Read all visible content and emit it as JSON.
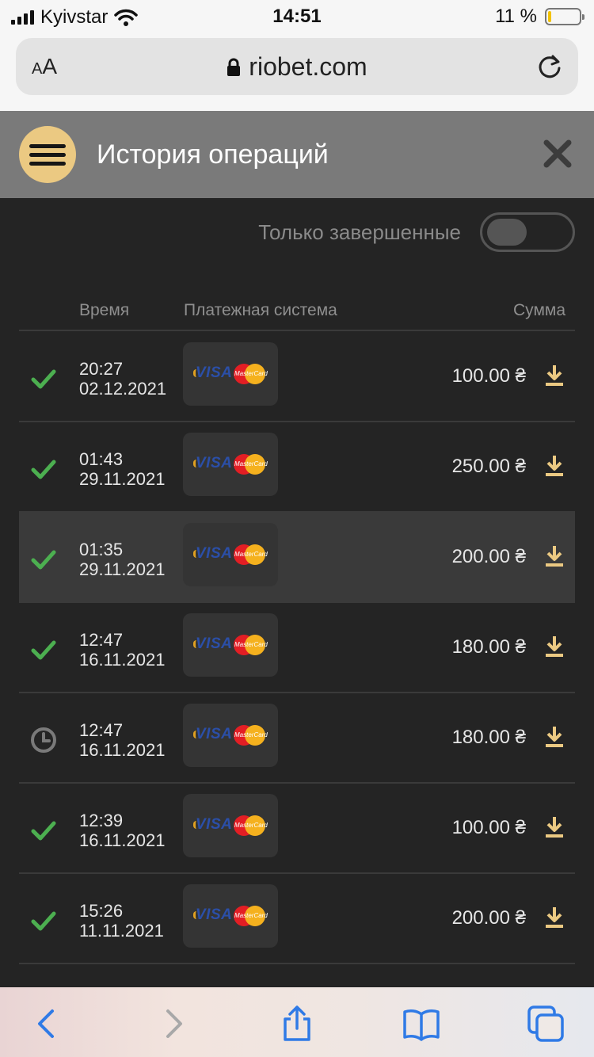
{
  "status_bar": {
    "carrier": "Kyivstar",
    "time": "14:51",
    "battery_percent": "11 %",
    "battery_level": 0.11
  },
  "browser": {
    "text_size_label": "AA",
    "url": "riobet.com"
  },
  "header": {
    "title": "История операций"
  },
  "filter": {
    "label": "Только завершенные",
    "enabled": false
  },
  "table": {
    "columns": {
      "time": "Время",
      "payment": "Платежная система",
      "amount": "Сумма"
    },
    "rows": [
      {
        "status": "completed",
        "time": "20:27",
        "date": "02.12.2021",
        "payment_icons": [
          "visa-icon",
          "mastercard-icon"
        ],
        "amount": "100.00 ₴"
      },
      {
        "status": "completed",
        "time": "01:43",
        "date": "29.11.2021",
        "payment_icons": [
          "visa-icon",
          "mastercard-icon"
        ],
        "amount": "250.00 ₴"
      },
      {
        "status": "completed",
        "time": "01:35",
        "date": "29.11.2021",
        "payment_icons": [
          "visa-icon",
          "mastercard-icon"
        ],
        "amount": "200.00 ₴"
      },
      {
        "status": "completed",
        "time": "12:47",
        "date": "16.11.2021",
        "payment_icons": [
          "visa-icon",
          "mastercard-icon"
        ],
        "amount": "180.00 ₴"
      },
      {
        "status": "pending",
        "time": "12:47",
        "date": "16.11.2021",
        "payment_icons": [
          "visa-icon",
          "mastercard-icon"
        ],
        "amount": "180.00 ₴"
      },
      {
        "status": "completed",
        "time": "12:39",
        "date": "16.11.2021",
        "payment_icons": [
          "visa-icon",
          "mastercard-icon"
        ],
        "amount": "100.00 ₴"
      },
      {
        "status": "completed",
        "time": "15:26",
        "date": "11.11.2021",
        "payment_icons": [
          "visa-icon",
          "mastercard-icon"
        ],
        "amount": "200.00 ₴"
      }
    ]
  },
  "logos": {
    "visa": "VISA",
    "mastercard": "MasterCard"
  },
  "colors": {
    "accent": "#ebc982",
    "success": "#4caf50",
    "header_bg": "#7a7a7a",
    "page_bg": "#242424",
    "ios_blue": "#2f7ae6"
  },
  "icons": {
    "completed": "check-icon",
    "pending": "clock-icon",
    "download": "download-icon",
    "menu": "hamburger-menu-icon",
    "close": "close-icon",
    "lock": "lock-icon",
    "reload": "reload-icon",
    "toolbar": [
      "back-icon",
      "forward-icon",
      "share-icon",
      "bookmarks-icon",
      "tabs-icon"
    ]
  }
}
